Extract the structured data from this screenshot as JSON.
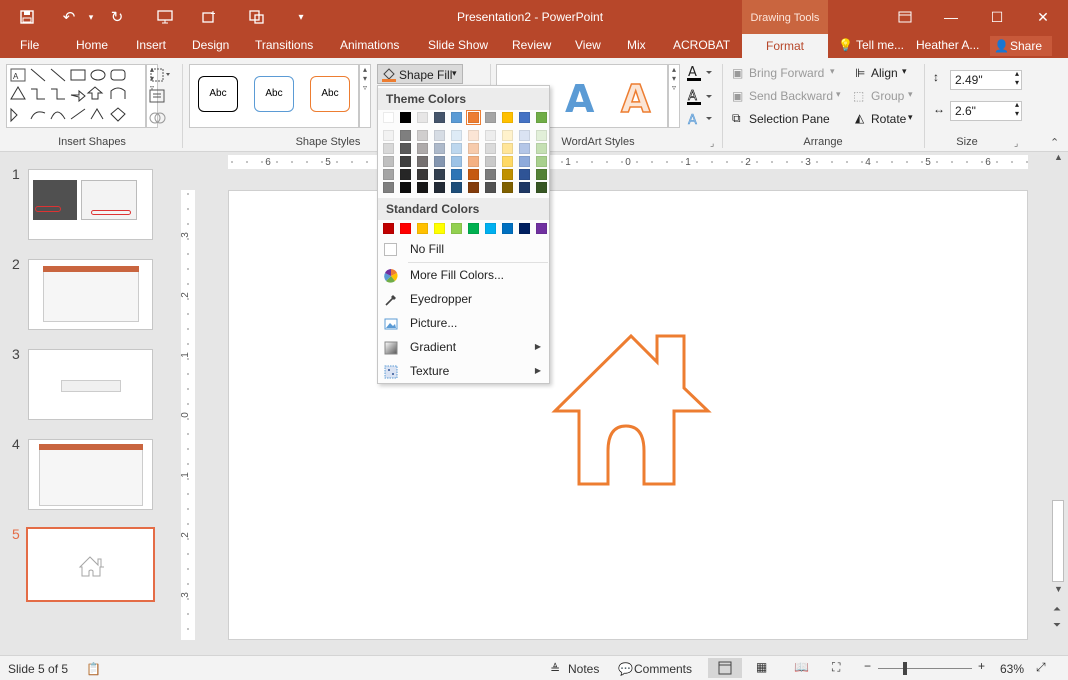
{
  "window": {
    "title": "Presentation2 - PowerPoint",
    "context_tab_group": "Drawing Tools"
  },
  "tabs": [
    "File",
    "Home",
    "Insert",
    "Design",
    "Transitions",
    "Animations",
    "Slide Show",
    "Review",
    "View",
    "Mix",
    "ACROBAT",
    "Format",
    "Tell me...",
    "Heather A..."
  ],
  "active_tab": "Format",
  "share_label": "Share",
  "ribbon": {
    "groups": {
      "insert_shapes": "Insert Shapes",
      "shape_styles": "Shape Styles",
      "wordart_styles": "WordArt Styles",
      "arrange": "Arrange",
      "size": "Size"
    },
    "style_sample": "Abc",
    "shape_fill_label": "Shape Fill",
    "wordart_letter": "A",
    "arrange": {
      "bring_forward": "Bring Forward",
      "send_backward": "Send Backward",
      "selection_pane": "Selection Pane",
      "align": "Align",
      "group": "Group",
      "rotate": "Rotate"
    },
    "size": {
      "height": "2.49\"",
      "width": "2.6\""
    }
  },
  "fill_menu": {
    "theme_colors_header": "Theme Colors",
    "standard_colors_header": "Standard Colors",
    "theme_top_row": [
      "#ffffff",
      "#000000",
      "#e7e6e6",
      "#44546a",
      "#5b9bd5",
      "#ed7d31",
      "#a5a5a5",
      "#ffc000",
      "#4472c4",
      "#70ad47"
    ],
    "theme_shades": [
      [
        "#f2f2f2",
        "#7f7f7f",
        "#d0cece",
        "#d6dce4",
        "#deebf6",
        "#fbe5d5",
        "#ededed",
        "#fff2cc",
        "#dae3f3",
        "#e2efd9"
      ],
      [
        "#d8d8d8",
        "#595959",
        "#aeaaaa",
        "#adb9ca",
        "#bdd7ee",
        "#f7cbac",
        "#dbdbdb",
        "#ffe599",
        "#b4c6e7",
        "#c5e0b3"
      ],
      [
        "#bfbfbf",
        "#3f3f3f",
        "#757070",
        "#8496b0",
        "#9dc3e6",
        "#f4b183",
        "#c9c9c9",
        "#ffd965",
        "#8eaadb",
        "#a8d08d"
      ],
      [
        "#a5a5a5",
        "#262626",
        "#3a3838",
        "#323f4f",
        "#2e75b5",
        "#c55a11",
        "#7b7b7b",
        "#bf9000",
        "#2f5496",
        "#538135"
      ],
      [
        "#7f7f7f",
        "#0c0c0c",
        "#171616",
        "#222a35",
        "#1e4e79",
        "#833c0b",
        "#525252",
        "#7f6000",
        "#1f3864",
        "#375623"
      ]
    ],
    "standard_colors": [
      "#c00000",
      "#ff0000",
      "#ffc000",
      "#ffff00",
      "#92d050",
      "#00b050",
      "#00b0f0",
      "#0070c0",
      "#002060",
      "#7030a0"
    ],
    "items": {
      "no_fill": "No Fill",
      "more_colors": "More Fill Colors...",
      "eyedropper": "Eyedropper",
      "picture": "Picture...",
      "gradient": "Gradient",
      "texture": "Texture"
    }
  },
  "thumbnails": [
    {
      "number": "1",
      "active": false
    },
    {
      "number": "2",
      "active": false
    },
    {
      "number": "3",
      "active": false
    },
    {
      "number": "4",
      "active": false
    },
    {
      "number": "5",
      "active": true
    }
  ],
  "ruler_h_labels": [
    "6",
    "5",
    "4",
    "3",
    "2",
    "1",
    "0",
    "1",
    "2",
    "3",
    "4",
    "5",
    "6"
  ],
  "ruler_v_labels": [
    "3",
    "2",
    "1",
    "0",
    "1",
    "2",
    "3"
  ],
  "status": {
    "slide_info": "Slide 5 of 5",
    "notes": "Notes",
    "comments": "Comments",
    "zoom": "63%"
  },
  "colors": {
    "accent": "#b7472a",
    "house_stroke": "#ed7d31",
    "active_thumb": "#e46c46"
  }
}
